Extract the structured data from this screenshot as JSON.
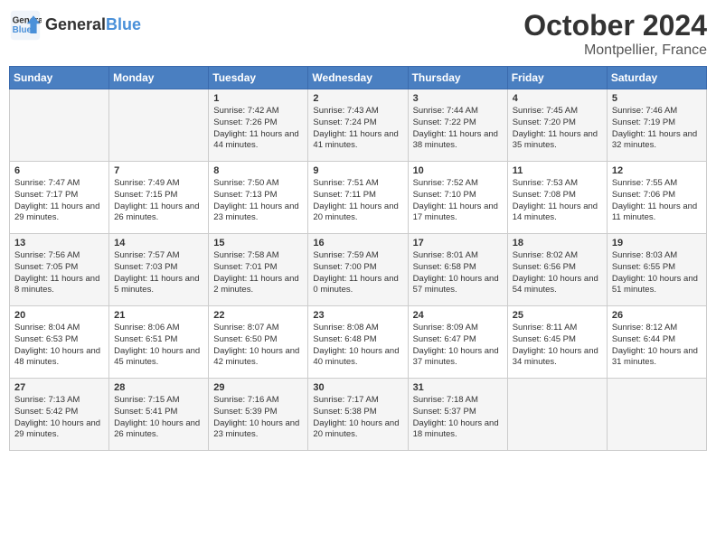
{
  "header": {
    "logo_line1": "General",
    "logo_line2": "Blue",
    "month": "October 2024",
    "location": "Montpellier, France"
  },
  "columns": [
    "Sunday",
    "Monday",
    "Tuesday",
    "Wednesday",
    "Thursday",
    "Friday",
    "Saturday"
  ],
  "weeks": [
    [
      {
        "day": "",
        "sunrise": "",
        "sunset": "",
        "daylight": ""
      },
      {
        "day": "",
        "sunrise": "",
        "sunset": "",
        "daylight": ""
      },
      {
        "day": "1",
        "sunrise": "Sunrise: 7:42 AM",
        "sunset": "Sunset: 7:26 PM",
        "daylight": "Daylight: 11 hours and 44 minutes."
      },
      {
        "day": "2",
        "sunrise": "Sunrise: 7:43 AM",
        "sunset": "Sunset: 7:24 PM",
        "daylight": "Daylight: 11 hours and 41 minutes."
      },
      {
        "day": "3",
        "sunrise": "Sunrise: 7:44 AM",
        "sunset": "Sunset: 7:22 PM",
        "daylight": "Daylight: 11 hours and 38 minutes."
      },
      {
        "day": "4",
        "sunrise": "Sunrise: 7:45 AM",
        "sunset": "Sunset: 7:20 PM",
        "daylight": "Daylight: 11 hours and 35 minutes."
      },
      {
        "day": "5",
        "sunrise": "Sunrise: 7:46 AM",
        "sunset": "Sunset: 7:19 PM",
        "daylight": "Daylight: 11 hours and 32 minutes."
      }
    ],
    [
      {
        "day": "6",
        "sunrise": "Sunrise: 7:47 AM",
        "sunset": "Sunset: 7:17 PM",
        "daylight": "Daylight: 11 hours and 29 minutes."
      },
      {
        "day": "7",
        "sunrise": "Sunrise: 7:49 AM",
        "sunset": "Sunset: 7:15 PM",
        "daylight": "Daylight: 11 hours and 26 minutes."
      },
      {
        "day": "8",
        "sunrise": "Sunrise: 7:50 AM",
        "sunset": "Sunset: 7:13 PM",
        "daylight": "Daylight: 11 hours and 23 minutes."
      },
      {
        "day": "9",
        "sunrise": "Sunrise: 7:51 AM",
        "sunset": "Sunset: 7:11 PM",
        "daylight": "Daylight: 11 hours and 20 minutes."
      },
      {
        "day": "10",
        "sunrise": "Sunrise: 7:52 AM",
        "sunset": "Sunset: 7:10 PM",
        "daylight": "Daylight: 11 hours and 17 minutes."
      },
      {
        "day": "11",
        "sunrise": "Sunrise: 7:53 AM",
        "sunset": "Sunset: 7:08 PM",
        "daylight": "Daylight: 11 hours and 14 minutes."
      },
      {
        "day": "12",
        "sunrise": "Sunrise: 7:55 AM",
        "sunset": "Sunset: 7:06 PM",
        "daylight": "Daylight: 11 hours and 11 minutes."
      }
    ],
    [
      {
        "day": "13",
        "sunrise": "Sunrise: 7:56 AM",
        "sunset": "Sunset: 7:05 PM",
        "daylight": "Daylight: 11 hours and 8 minutes."
      },
      {
        "day": "14",
        "sunrise": "Sunrise: 7:57 AM",
        "sunset": "Sunset: 7:03 PM",
        "daylight": "Daylight: 11 hours and 5 minutes."
      },
      {
        "day": "15",
        "sunrise": "Sunrise: 7:58 AM",
        "sunset": "Sunset: 7:01 PM",
        "daylight": "Daylight: 11 hours and 2 minutes."
      },
      {
        "day": "16",
        "sunrise": "Sunrise: 7:59 AM",
        "sunset": "Sunset: 7:00 PM",
        "daylight": "Daylight: 11 hours and 0 minutes."
      },
      {
        "day": "17",
        "sunrise": "Sunrise: 8:01 AM",
        "sunset": "Sunset: 6:58 PM",
        "daylight": "Daylight: 10 hours and 57 minutes."
      },
      {
        "day": "18",
        "sunrise": "Sunrise: 8:02 AM",
        "sunset": "Sunset: 6:56 PM",
        "daylight": "Daylight: 10 hours and 54 minutes."
      },
      {
        "day": "19",
        "sunrise": "Sunrise: 8:03 AM",
        "sunset": "Sunset: 6:55 PM",
        "daylight": "Daylight: 10 hours and 51 minutes."
      }
    ],
    [
      {
        "day": "20",
        "sunrise": "Sunrise: 8:04 AM",
        "sunset": "Sunset: 6:53 PM",
        "daylight": "Daylight: 10 hours and 48 minutes."
      },
      {
        "day": "21",
        "sunrise": "Sunrise: 8:06 AM",
        "sunset": "Sunset: 6:51 PM",
        "daylight": "Daylight: 10 hours and 45 minutes."
      },
      {
        "day": "22",
        "sunrise": "Sunrise: 8:07 AM",
        "sunset": "Sunset: 6:50 PM",
        "daylight": "Daylight: 10 hours and 42 minutes."
      },
      {
        "day": "23",
        "sunrise": "Sunrise: 8:08 AM",
        "sunset": "Sunset: 6:48 PM",
        "daylight": "Daylight: 10 hours and 40 minutes."
      },
      {
        "day": "24",
        "sunrise": "Sunrise: 8:09 AM",
        "sunset": "Sunset: 6:47 PM",
        "daylight": "Daylight: 10 hours and 37 minutes."
      },
      {
        "day": "25",
        "sunrise": "Sunrise: 8:11 AM",
        "sunset": "Sunset: 6:45 PM",
        "daylight": "Daylight: 10 hours and 34 minutes."
      },
      {
        "day": "26",
        "sunrise": "Sunrise: 8:12 AM",
        "sunset": "Sunset: 6:44 PM",
        "daylight": "Daylight: 10 hours and 31 minutes."
      }
    ],
    [
      {
        "day": "27",
        "sunrise": "Sunrise: 7:13 AM",
        "sunset": "Sunset: 5:42 PM",
        "daylight": "Daylight: 10 hours and 29 minutes."
      },
      {
        "day": "28",
        "sunrise": "Sunrise: 7:15 AM",
        "sunset": "Sunset: 5:41 PM",
        "daylight": "Daylight: 10 hours and 26 minutes."
      },
      {
        "day": "29",
        "sunrise": "Sunrise: 7:16 AM",
        "sunset": "Sunset: 5:39 PM",
        "daylight": "Daylight: 10 hours and 23 minutes."
      },
      {
        "day": "30",
        "sunrise": "Sunrise: 7:17 AM",
        "sunset": "Sunset: 5:38 PM",
        "daylight": "Daylight: 10 hours and 20 minutes."
      },
      {
        "day": "31",
        "sunrise": "Sunrise: 7:18 AM",
        "sunset": "Sunset: 5:37 PM",
        "daylight": "Daylight: 10 hours and 18 minutes."
      },
      {
        "day": "",
        "sunrise": "",
        "sunset": "",
        "daylight": ""
      },
      {
        "day": "",
        "sunrise": "",
        "sunset": "",
        "daylight": ""
      }
    ]
  ]
}
